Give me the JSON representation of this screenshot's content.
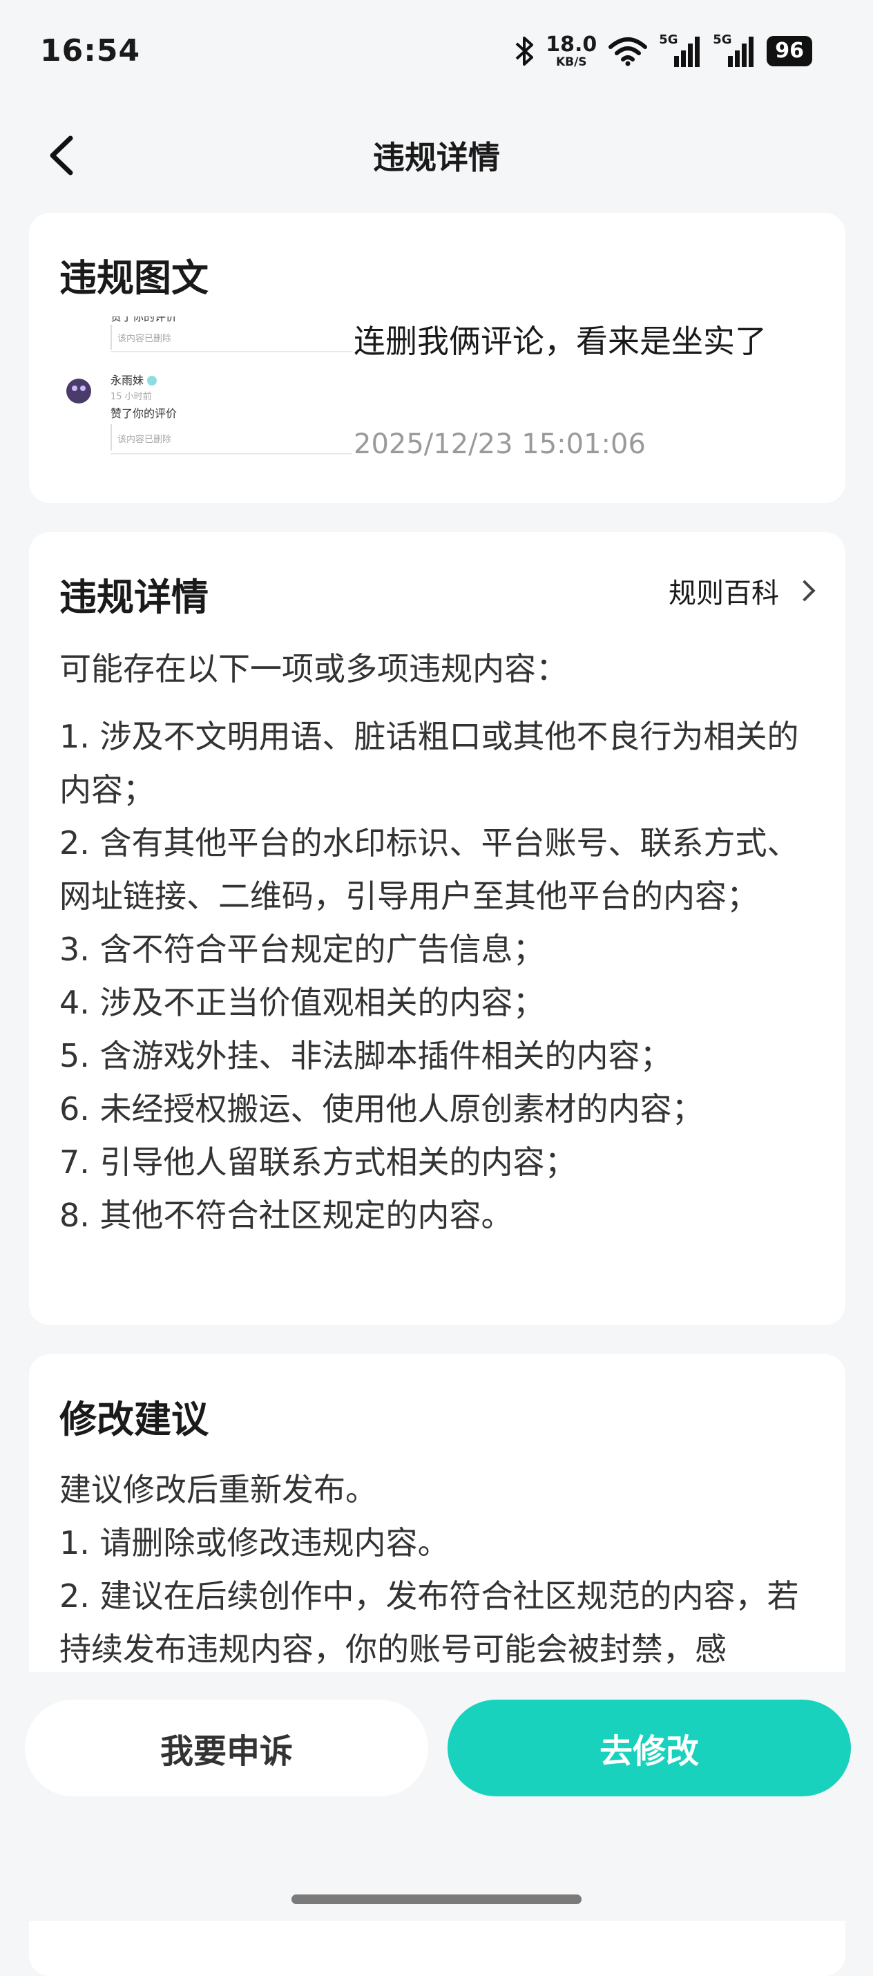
{
  "status_bar": {
    "time": "16:54",
    "net_speed_value": "18.0",
    "net_speed_unit": "KB/S",
    "signal1_label": "5G",
    "signal2_label": "5G",
    "battery": "96",
    "icons": [
      "bluetooth-icon",
      "wifi-icon",
      "signal-icon",
      "signal-icon",
      "battery-icon"
    ]
  },
  "header": {
    "title": "违规详情",
    "back_icon": "chevron-left-icon"
  },
  "violation_post": {
    "section_title": "违规图文",
    "thumbnail": {
      "top_partial": "赞了你的评价",
      "deleted1": "该内容已删除",
      "user": "永雨妹",
      "time": "15 小时前",
      "action": "赞了你的评价",
      "deleted2": "该内容已删除"
    },
    "text": "连删我俩评论，看来是坐实了",
    "timestamp": "2025/12/23 15:01:06"
  },
  "violation_detail": {
    "section_title": "违规详情",
    "rules_link": "规则百科",
    "intro": "可能存在以下一项或多项违规内容：",
    "items": [
      "1. 涉及不文明用语、脏话粗口或其他不良行为相关的内容；",
      "2. 含有其他平台的水印标识、平台账号、联系方式、网址链接、二维码，引导用户至其他平台的内容；",
      "3. 含不符合平台规定的广告信息；",
      "4. 涉及不正当价值观相关的内容；",
      "5. 含游戏外挂、非法脚本插件相关的内容；",
      "6. 未经授权搬运、使用他人原创素材的内容；",
      "7. 引导他人留联系方式相关的内容；",
      "8. 其他不符合社区规定的内容。"
    ]
  },
  "suggestion": {
    "section_title": "修改建议",
    "lines": [
      "建议修改后重新发布。",
      "1. 请删除或修改违规内容。",
      "2. 建议在后续创作中，发布符合社区规范的内容，若持续发布违规内容，你的账号可能会被封禁，感"
    ]
  },
  "buttons": {
    "appeal": "我要申诉",
    "modify": "去修改"
  },
  "colors": {
    "accent": "#18d2bd",
    "background": "#f5f6f8",
    "timestamp": "#9a9a9a"
  }
}
